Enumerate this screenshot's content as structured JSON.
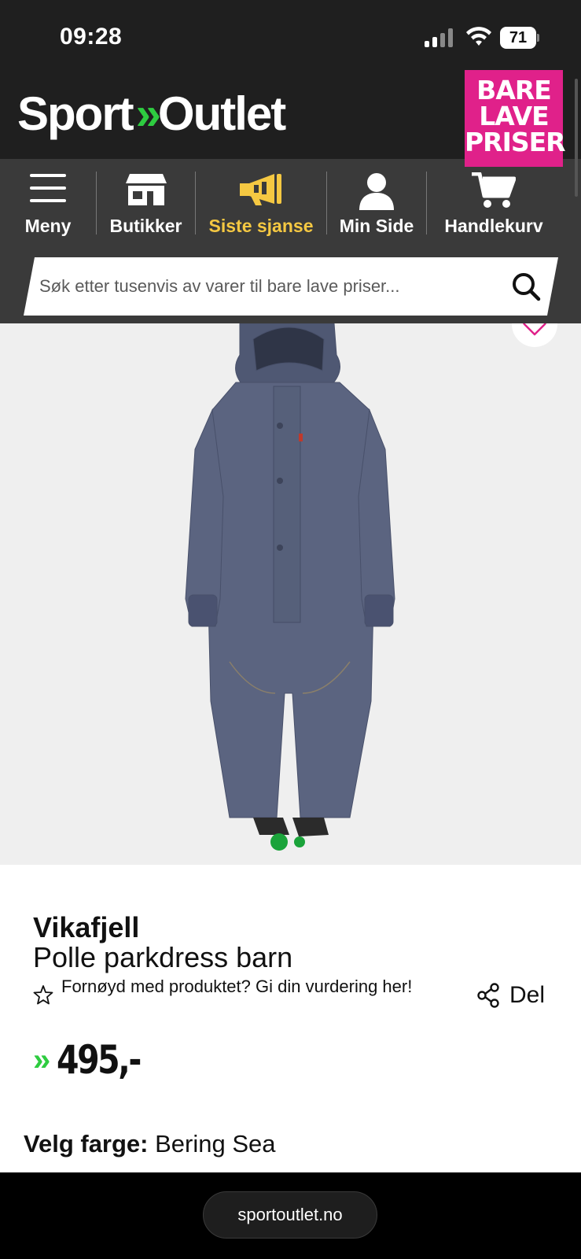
{
  "status_bar": {
    "time": "09:28",
    "battery": "71"
  },
  "header": {
    "logo_left": "Sport",
    "logo_right": "Outlet",
    "badge_lines": [
      "BARE",
      "LAVE",
      "PRISER"
    ]
  },
  "nav": {
    "items": [
      {
        "label": "Meny",
        "icon": "menu-icon"
      },
      {
        "label": "Butikker",
        "icon": "store-icon"
      },
      {
        "label": "Siste sjanse",
        "icon": "megaphone-icon",
        "active": true
      },
      {
        "label": "Min Side",
        "icon": "user-icon"
      },
      {
        "label": "Handlekurv",
        "icon": "cart-icon"
      }
    ],
    "active_color": "#f5c842"
  },
  "search": {
    "placeholder": "Søk etter tusenvis av varer til bare lave priser..."
  },
  "product": {
    "brand": "Vikafjell",
    "name": "Polle parkdress barn",
    "rating_prompt": "Fornøyd med produktet? Gi din vurdering her!",
    "share_label": "Del",
    "price": "495,-",
    "color_label": "Velg farge:",
    "color_value": "Bering Sea",
    "image_count": 2,
    "active_image": 1
  },
  "browser": {
    "url": "sportoutlet.no"
  },
  "colors": {
    "brand_pink": "#e0218a",
    "brand_green": "#2ecc40",
    "header_dark": "#1f1f1f",
    "nav_dark": "#3a3a3a"
  }
}
